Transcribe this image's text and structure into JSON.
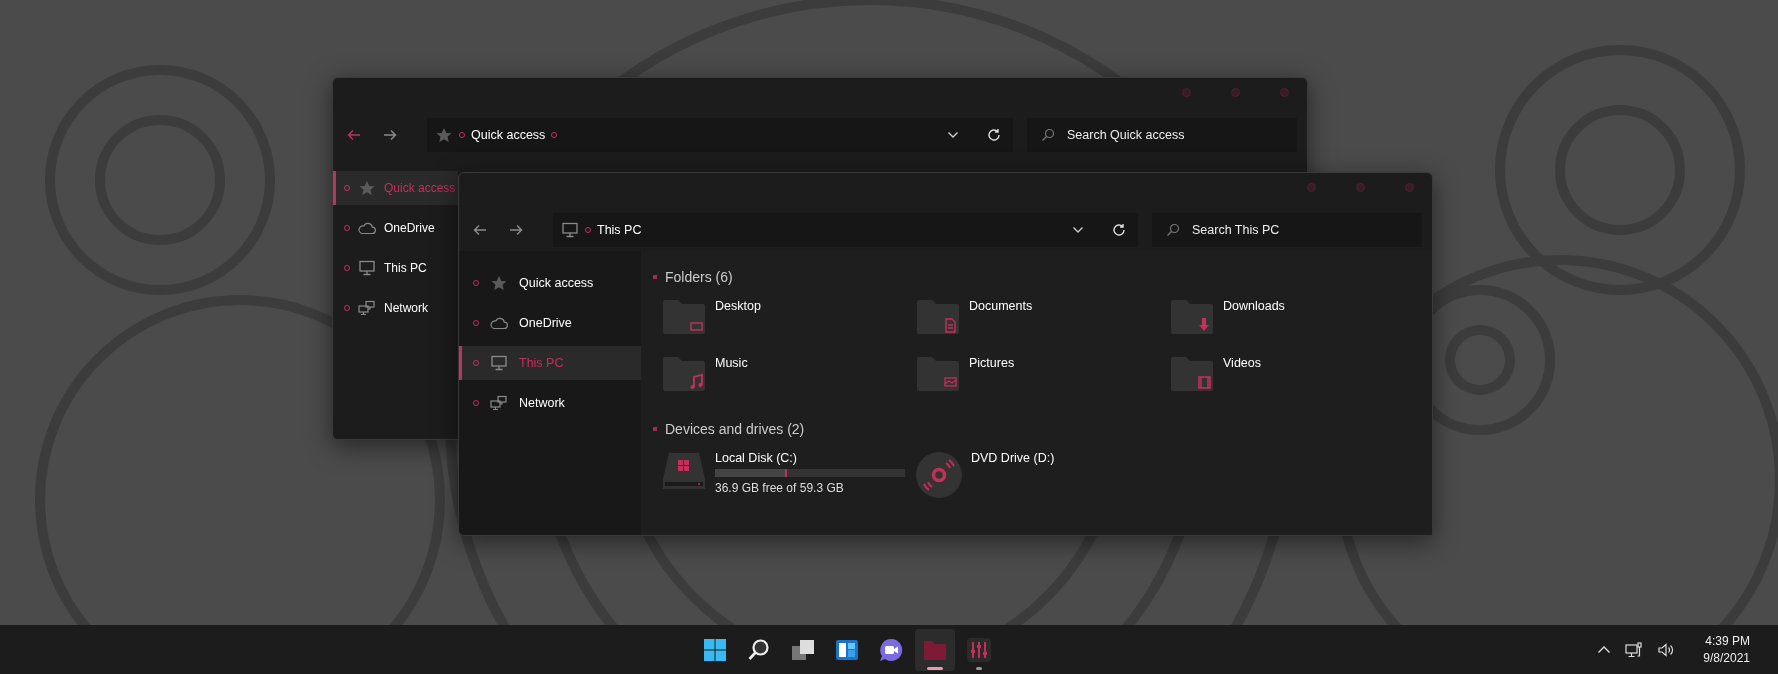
{
  "windows": [
    {
      "back_enabled": true,
      "address": {
        "kind": "star",
        "text": "Quick access"
      },
      "search": {
        "placeholder": "Search Quick access"
      },
      "sidebar": [
        {
          "label": "Quick access",
          "kind": "star",
          "selected": true
        },
        {
          "label": "OneDrive",
          "kind": "cloud",
          "selected": false
        },
        {
          "label": "This PC",
          "kind": "monitor",
          "selected": false
        },
        {
          "label": "Network",
          "kind": "network",
          "selected": false
        }
      ]
    },
    {
      "back_enabled": false,
      "address": {
        "kind": "monitor",
        "text": "This PC"
      },
      "search": {
        "placeholder": "Search This PC"
      },
      "sidebar": [
        {
          "label": "Quick access",
          "kind": "star",
          "selected": false
        },
        {
          "label": "OneDrive",
          "kind": "cloud",
          "selected": false
        },
        {
          "label": "This PC",
          "kind": "monitor",
          "selected": true
        },
        {
          "label": "Network",
          "kind": "network",
          "selected": false
        }
      ],
      "sections": [
        {
          "title": "Folders (6)",
          "items": [
            {
              "kind": "desktop",
              "name": "Desktop"
            },
            {
              "kind": "document",
              "name": "Documents"
            },
            {
              "kind": "download",
              "name": "Downloads"
            },
            {
              "kind": "music",
              "name": "Music"
            },
            {
              "kind": "picture",
              "name": "Pictures"
            },
            {
              "kind": "video",
              "name": "Videos"
            }
          ]
        },
        {
          "title": "Devices and drives (2)",
          "items": [
            {
              "kind": "disk",
              "name": "Local Disk (C:)",
              "level": 0.38,
              "detail": "36.9 GB free of 59.3 GB"
            },
            {
              "kind": "dvd",
              "name": "DVD Drive (D:)"
            }
          ]
        }
      ]
    }
  ],
  "taskbar": {
    "apps": [
      {
        "kind": "start",
        "active": false,
        "running": false
      },
      {
        "kind": "search",
        "active": false,
        "running": false
      },
      {
        "kind": "taskview",
        "active": false,
        "running": false
      },
      {
        "kind": "widgets",
        "active": false,
        "running": false
      },
      {
        "kind": "chat",
        "active": false,
        "running": false
      },
      {
        "kind": "explorer",
        "active": true,
        "running": true
      },
      {
        "kind": "mixer",
        "active": false,
        "running": true
      }
    ],
    "clock": {
      "time": "4:39 PM",
      "date": "9/8/2021"
    }
  }
}
